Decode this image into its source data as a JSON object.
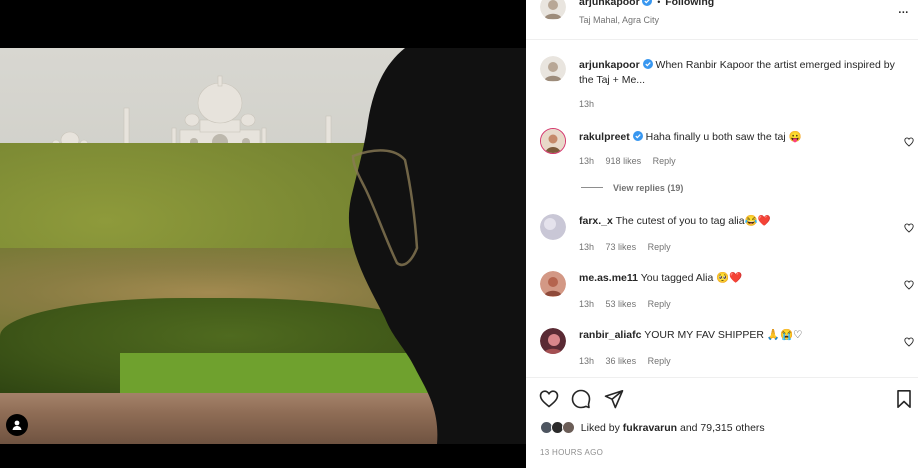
{
  "post": {
    "author": "arjunkapoor",
    "follow_status": "Following",
    "separator": "•",
    "location": "Taj Mahal, Agra City",
    "more_label": "...",
    "caption_author": "arjunkapoor",
    "caption": "When Ranbir Kapoor the artist emerged inspired by the Taj + Me...",
    "caption_age": "13h"
  },
  "comments": [
    {
      "user": "rakulpreet",
      "verified": true,
      "text": "Haha finally u both saw the taj 😛",
      "age": "13h",
      "likes": "918 likes",
      "reply": "Reply",
      "avatar_color": "#c58a6a"
    },
    {
      "user": "farx._x",
      "verified": false,
      "text": "The cutest of you to tag alia😂❤️",
      "age": "13h",
      "likes": "73 likes",
      "reply": "Reply",
      "avatar_color": "#b9b7c9"
    },
    {
      "user": "me.as.me11",
      "verified": false,
      "text": "You tagged Alia 🥺❤️",
      "age": "13h",
      "likes": "53 likes",
      "reply": "Reply",
      "avatar_color": "#c9826d"
    },
    {
      "user": "ranbir_aliafc",
      "verified": false,
      "text": "YOUR MY FAV SHIPPER 🙏😭♡",
      "age": "13h",
      "likes": "36 likes",
      "reply": "Reply",
      "avatar_color": "#a44f52"
    }
  ],
  "view_replies": "View replies (19)",
  "likes": {
    "prefix": "Liked by",
    "user": "fukravarun",
    "suffix": "and 79,315 others"
  },
  "time_ago": "13 HOURS AGO",
  "colors": {
    "verified": "#3897f0",
    "text": "#262626",
    "muted": "#737373"
  },
  "icons": [
    "heart-icon",
    "comment-icon",
    "share-icon",
    "bookmark-icon",
    "user-tag-icon",
    "verified-icon",
    "more-icon"
  ]
}
